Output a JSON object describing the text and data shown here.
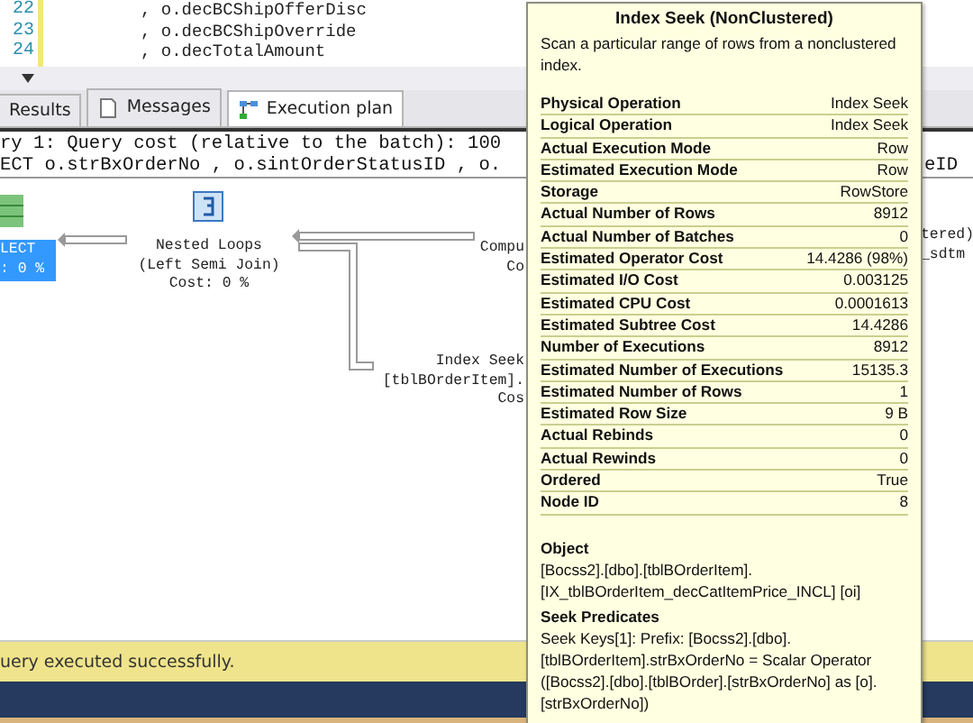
{
  "editor": {
    "lines": [
      {
        "number": "22",
        "code": ", o.decBCShipOfferDisc"
      },
      {
        "number": "23",
        "code": ", o.decBCShipOverride"
      },
      {
        "number": "24",
        "code": ", o.decTotalAmount"
      }
    ]
  },
  "result_tabs": [
    {
      "label": "Results",
      "kind": "grid",
      "selected": false
    },
    {
      "label": "Messages",
      "kind": "messages",
      "selected": false
    },
    {
      "label": "Execution plan",
      "kind": "plan",
      "selected": true
    }
  ],
  "query_header": {
    "lines": [
      "ry 1: Query cost (relative to the batch): 100",
      "ECT o.strBxOrderNo , o.sintOrderStatusID , o."
    ],
    "right_fragment": "eID"
  },
  "plan_nodes": [
    {
      "kind": "select",
      "lines": [
        "LECT",
        ": 0 %"
      ],
      "selected": true
    },
    {
      "kind": "nested_loops",
      "lines": [
        "Nested Loops",
        "(Left Semi Join)",
        "Cost: 0 %"
      ],
      "selected": false
    },
    {
      "kind": "compute",
      "lines": [
        "Compu",
        "Co"
      ],
      "selected": false
    },
    {
      "kind": "index_seek",
      "lines": [
        "Index Seek",
        "[tblBOrderItem].",
        "Cos"
      ],
      "selected": false
    },
    {
      "kind": "fragment",
      "lines": [
        "tered)",
        "_sdtm"
      ],
      "selected": false
    }
  ],
  "tooltip": {
    "title": "Index Seek (NonClustered)",
    "description": "Scan a particular range of rows from a nonclustered index.",
    "properties": [
      {
        "name": "Physical Operation",
        "value": "Index Seek"
      },
      {
        "name": "Logical Operation",
        "value": "Index Seek"
      },
      {
        "name": "Actual Execution Mode",
        "value": "Row"
      },
      {
        "name": "Estimated Execution Mode",
        "value": "Row"
      },
      {
        "name": "Storage",
        "value": "RowStore"
      },
      {
        "name": "Actual Number of Rows",
        "value": "8912"
      },
      {
        "name": "Actual Number of Batches",
        "value": "0"
      },
      {
        "name": "Estimated Operator Cost",
        "value": "14.4286 (98%)"
      },
      {
        "name": "Estimated I/O Cost",
        "value": "0.003125"
      },
      {
        "name": "Estimated CPU Cost",
        "value": "0.0001613"
      },
      {
        "name": "Estimated Subtree Cost",
        "value": "14.4286"
      },
      {
        "name": "Number of Executions",
        "value": "8912"
      },
      {
        "name": "Estimated Number of Executions",
        "value": "15135.3"
      },
      {
        "name": "Estimated Number of Rows",
        "value": "1"
      },
      {
        "name": "Estimated Row Size",
        "value": "9 B"
      },
      {
        "name": "Actual Rebinds",
        "value": "0"
      },
      {
        "name": "Actual Rewinds",
        "value": "0"
      },
      {
        "name": "Ordered",
        "value": "True"
      },
      {
        "name": "Node ID",
        "value": "8"
      }
    ],
    "sections": [
      {
        "heading": "Object",
        "text": "[Bocss2].[dbo].[tblBOrderItem].[IX_tblBOrderItem_decCatItemPrice_INCL] [oi]"
      },
      {
        "heading": "Seek Predicates",
        "text": "Seek Keys[1]: Prefix: [Bocss2].[dbo].[tblBOrderItem].strBxOrderNo = Scalar Operator ([Bocss2].[dbo].[tblBOrder].[strBxOrderNo] as [o].[strBxOrderNo])"
      }
    ]
  },
  "status_bar": {
    "message": "uery executed successfully."
  }
}
